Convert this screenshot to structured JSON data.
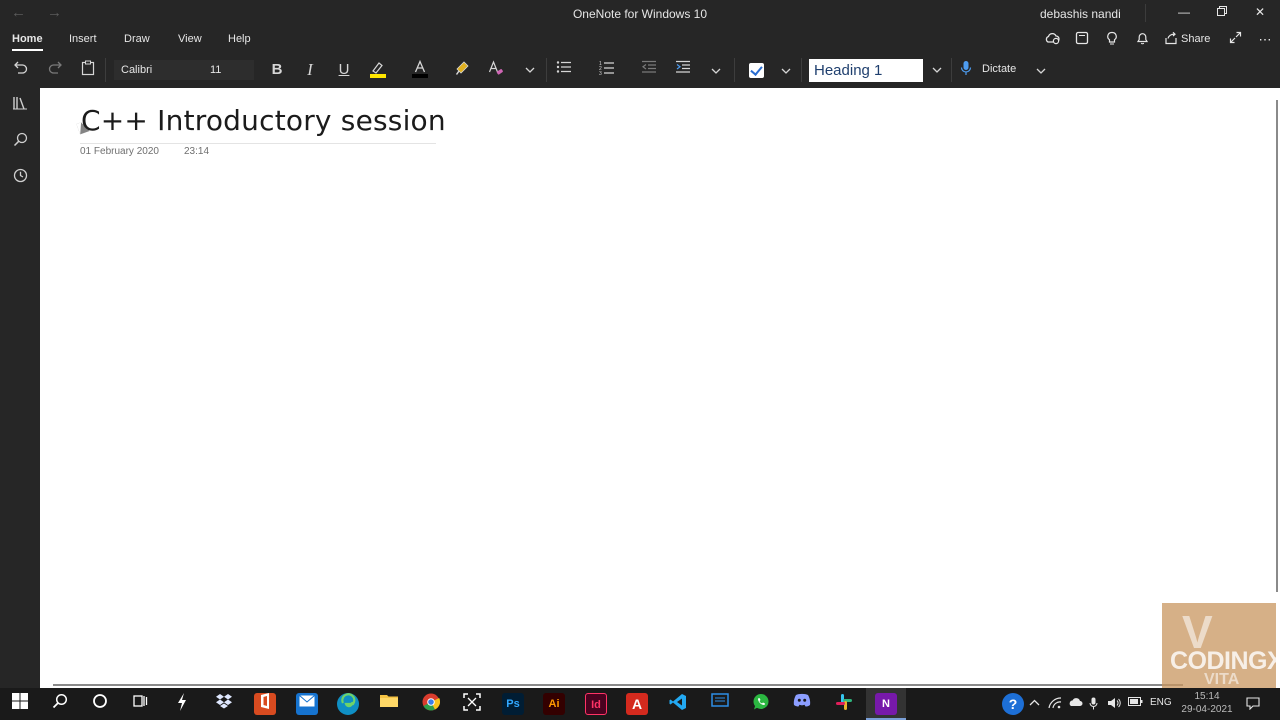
{
  "window": {
    "title": "OneNote for Windows 10",
    "user": "debashis nandi",
    "back_icon": "←",
    "forward_icon": "→"
  },
  "menu": {
    "tabs": [
      "Home",
      "Insert",
      "Draw",
      "View",
      "Help"
    ],
    "active_tab": "Home",
    "share_label": "Share"
  },
  "ribbon": {
    "font_name": "Calibri",
    "font_size": "11",
    "style": "Heading 1",
    "dictate_label": "Dictate",
    "bold": "B",
    "italic": "I",
    "underline": "U",
    "highlight_color": "#ffe600",
    "font_color": "#000000"
  },
  "page": {
    "title": "C++ Introductory session",
    "date": "01 February 2020",
    "time": "23:14"
  },
  "watermark": {
    "text": "CODINGX VITA"
  },
  "taskbar": {
    "language": "ENG",
    "time": "15:14",
    "date": "29-04-2021",
    "apps": [
      "Windows",
      "Search",
      "Cortana",
      "Task View",
      "Launcher",
      "Dropbox",
      "Office",
      "Mail",
      "Edge",
      "File Explorer",
      "Chrome",
      "Snipping",
      "Photoshop",
      "Illustrator",
      "InDesign",
      "Acrobat",
      "VS Code",
      "Reader",
      "WhatsApp",
      "Discord",
      "Slack",
      "OneNote"
    ],
    "app_labels": {
      "photoshop": "Ps",
      "illustrator": "Ai",
      "indesign": "Id",
      "acrobat": "A",
      "onenote": "N"
    }
  }
}
